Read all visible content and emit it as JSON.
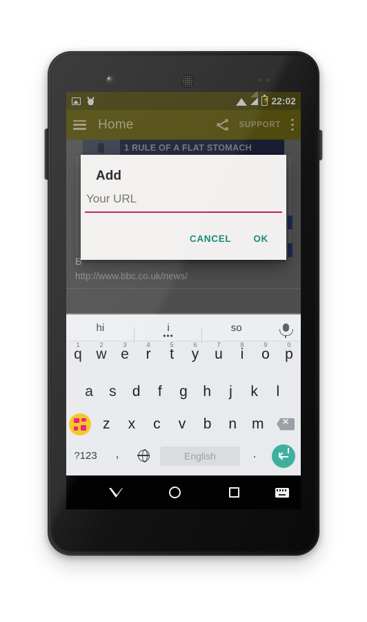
{
  "statusbar": {
    "clock": "22:02",
    "icons": [
      "image-icon",
      "android-debug-icon",
      "wifi-icon",
      "signal-icon",
      "battery-charging-icon"
    ]
  },
  "actionbar": {
    "menu_icon": "hamburger-menu-icon",
    "title": "Home",
    "share_icon": "share-icon",
    "support_label": "SUPPORT",
    "overflow_icon": "overflow-menu-icon"
  },
  "app_content": {
    "ad_banner_text": "1 RULE OF A FLAT STOMACH",
    "list_item_title": "B",
    "list_item_url": "http://www.bbc.co.uk/news/"
  },
  "dialog": {
    "title": "Add",
    "input_value": "",
    "input_placeholder": "Your URL",
    "underline_color": "#c2185b",
    "cancel_label": "CANCEL",
    "ok_label": "OK",
    "button_color": "#1b8a78"
  },
  "keyboard": {
    "suggestions": [
      {
        "text": "hi",
        "active": false
      },
      {
        "text": "i",
        "active": true
      },
      {
        "text": "so",
        "active": false
      }
    ],
    "mic_icon": "microphone-icon",
    "row1": [
      {
        "letter": "q",
        "num": "1"
      },
      {
        "letter": "w",
        "num": "2"
      },
      {
        "letter": "e",
        "num": "3"
      },
      {
        "letter": "r",
        "num": "4"
      },
      {
        "letter": "t",
        "num": "5"
      },
      {
        "letter": "y",
        "num": "6"
      },
      {
        "letter": "u",
        "num": "7"
      },
      {
        "letter": "i",
        "num": "8"
      },
      {
        "letter": "o",
        "num": "9"
      },
      {
        "letter": "p",
        "num": "0"
      }
    ],
    "row2": [
      "a",
      "s",
      "d",
      "f",
      "g",
      "h",
      "j",
      "k",
      "l"
    ],
    "row3": [
      "z",
      "x",
      "c",
      "v",
      "b",
      "n",
      "m"
    ],
    "shift_icon": "theme-shift-icon",
    "backspace_icon": "backspace-icon",
    "symbols_label": "?123",
    "comma_label": ",",
    "globe_icon": "language-globe-icon",
    "space_label": "English",
    "period_label": ".",
    "enter_icon": "enter-key-icon",
    "theme_circle_color": "#f5c518",
    "theme_tile_color": "#e8197d",
    "enter_key_color": "#3fb0a0"
  },
  "navbar": {
    "back_icon": "hide-keyboard-icon",
    "home_icon": "home-circle-icon",
    "recents_icon": "recents-square-icon",
    "keyboard_switch_icon": "keyboard-switch-icon"
  }
}
